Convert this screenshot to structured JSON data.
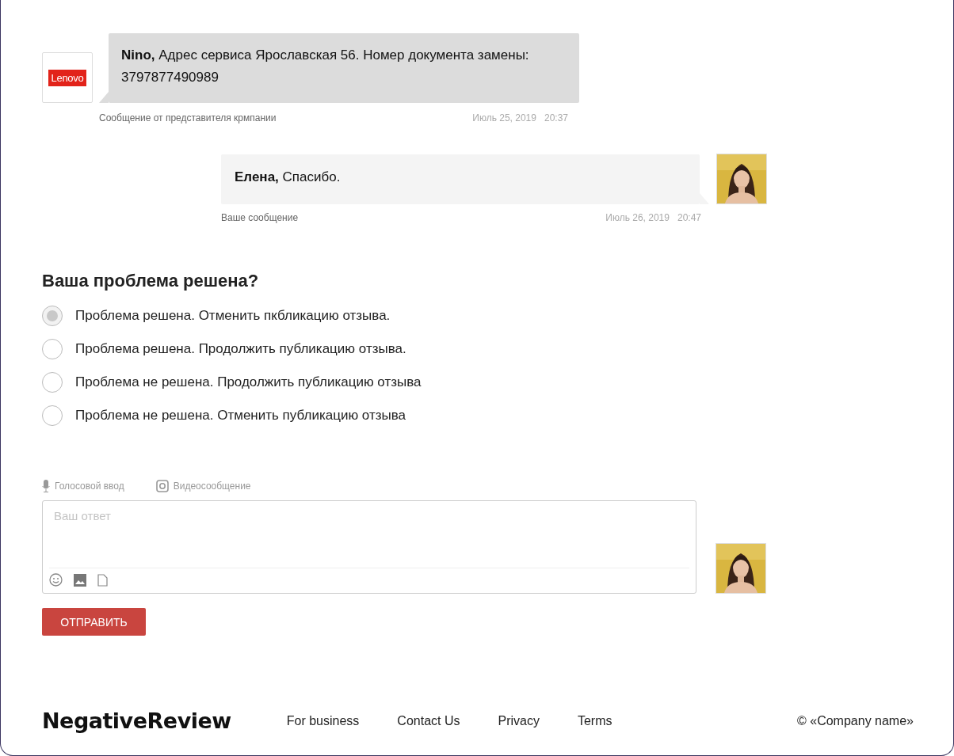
{
  "messages": [
    {
      "kind": "company",
      "logo": "Lenovo",
      "author": "Nino,",
      "text": "Адрес сервиса Ярославская 56. Номер документа замены: 3797877490989",
      "caption": "Сообщение от представителя крмпании",
      "date": "Июль 25, 2019",
      "time": "20:37"
    },
    {
      "kind": "user",
      "author": "Елена,",
      "text": "Спасибо.",
      "caption": "Ваше сообщение",
      "date": "Июль 26, 2019",
      "time": "20:47"
    }
  ],
  "question": {
    "title": "Ваша проблема решена?",
    "options": [
      {
        "label": "Проблема решена. Отменить пкбликацию отзыва.",
        "selected": true
      },
      {
        "label": "Проблема решена. Продолжить публикацию отзыва.",
        "selected": false
      },
      {
        "label": "Проблема не решена. Продолжить публикацию отзыва",
        "selected": false
      },
      {
        "label": "Проблема не решена. Отменить публикацию отзыва",
        "selected": false
      }
    ]
  },
  "composer": {
    "voice": "Голосовой ввод",
    "video": "Видеосообщение",
    "placeholder": "Ваш ответ",
    "send": "ОТПРАВИТЬ"
  },
  "footer": {
    "brand": "NegativeReview",
    "links": [
      "For business",
      "Contact Us",
      "Privacy",
      "Terms"
    ],
    "copyright": "© «Company name»"
  }
}
